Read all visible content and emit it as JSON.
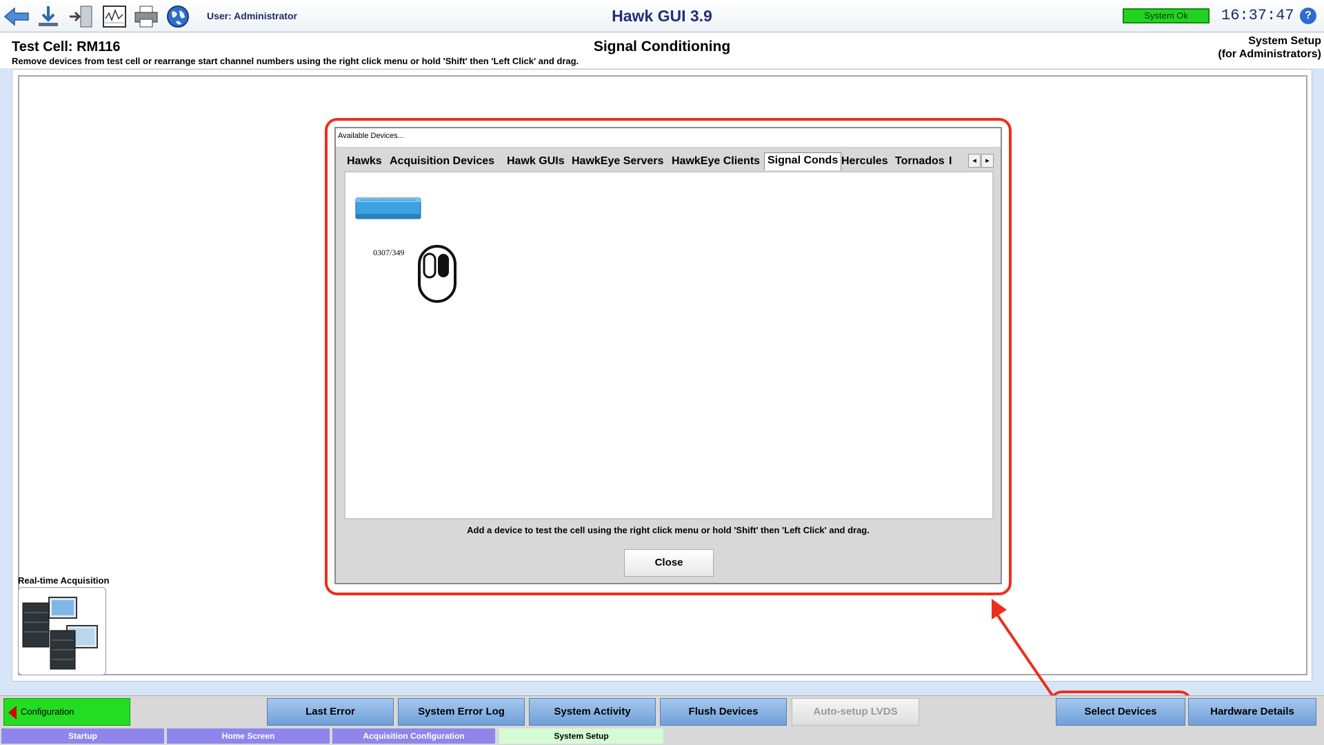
{
  "toolbar": {
    "user_label": "User: Administrator",
    "app_title": "Hawk GUI 3.9",
    "status": "System Ok",
    "clock": "16:37:47",
    "help": "?"
  },
  "header": {
    "test_cell": "Test Cell: RM116",
    "instructions": "Remove devices from test cell or rearrange start channel numbers using the right click menu or hold 'Shift' then 'Left Click' and drag.",
    "section_title": "Signal Conditioning",
    "system_setup_line1": "System Setup",
    "system_setup_line2": "(for Administrators)"
  },
  "dialog": {
    "title": "Available Devices...",
    "tabs": [
      "Hawks",
      "Acquisition Devices",
      "Hawk GUIs",
      "HawkEye Servers",
      "HawkEye Clients",
      "Signal Conds",
      "Hercules",
      "Tornados",
      "I"
    ],
    "active_tab": "Signal Conds",
    "device_label": "0307/349",
    "help_text": "Add a device to test the cell using the right click menu or hold 'Shift' then 'Left Click' and drag.",
    "close_label": "Close"
  },
  "realtime": {
    "label": "Real-time Acquisition"
  },
  "bottom": {
    "config_label": "Configuration",
    "buttons": [
      "Last Error",
      "System Error Log",
      "System Activity",
      "Flush Devices",
      "Auto-setup LVDS",
      "Select Devices",
      "Hardware Details"
    ]
  },
  "nav": {
    "tabs": [
      "Startup",
      "Home Screen",
      "Acquisition Configuration",
      "System Setup"
    ],
    "active": "System Setup"
  },
  "colors": {
    "status_ok": "#22d422",
    "annotation_red": "#ec2f1b",
    "button_blue": "#7fa9de",
    "nav_purple": "#8e86ec"
  }
}
